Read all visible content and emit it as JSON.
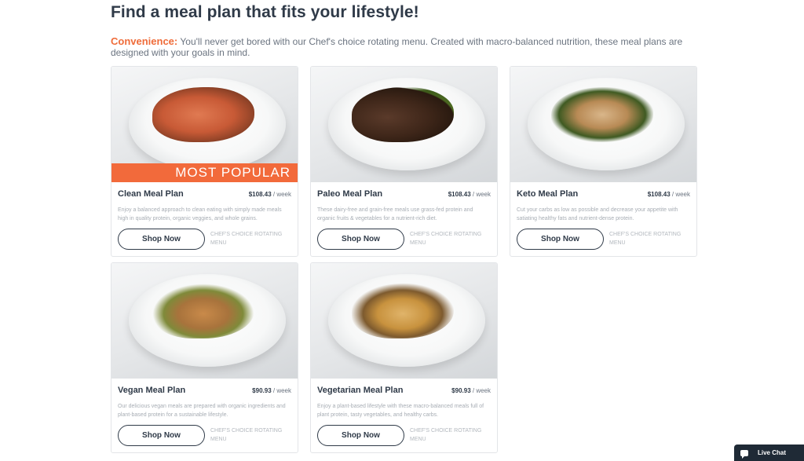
{
  "page": {
    "title": "Find a meal plan that fits your lifestyle!",
    "intro_keyword": "Convenience:",
    "intro_text": "You'll never get bored with our Chef's choice rotating menu. Created with macro-balanced nutrition, these meal plans are designed with your goals in mind."
  },
  "plans": [
    {
      "name": "Clean Meal Plan",
      "price": "$108.43",
      "price_unit": "/ week",
      "badge": "MOST POPULAR",
      "description": "Enjoy a balanced approach to clean eating with simply made meals high in quality protein, organic veggies, and whole grains.",
      "button": "Shop Now",
      "note": "CHEF'S CHOICE ROTATING MENU"
    },
    {
      "name": "Paleo Meal Plan",
      "price": "$108.43",
      "price_unit": "/ week",
      "description": "These dairy-free and grain-free meals use grass-fed protein and organic fruits & vegetables for a nutrient-rich diet.",
      "button": "Shop Now",
      "note": "CHEF'S CHOICE ROTATING MENU"
    },
    {
      "name": "Keto Meal Plan",
      "price": "$108.43",
      "price_unit": "/ week",
      "description": "Cut your carbs as low as possible and decrease your appetite with satiating healthy fats and nutrient-dense protein.",
      "button": "Shop Now",
      "note": "CHEF'S CHOICE ROTATING MENU"
    },
    {
      "name": "Vegan Meal Plan",
      "price": "$90.93",
      "price_unit": "/ week",
      "description": "Our delicious vegan meals are prepared with organic ingredients and plant-based protein for a sustainable lifestyle.",
      "button": "Shop Now",
      "note": "CHEF'S CHOICE ROTATING MENU"
    },
    {
      "name": "Vegetarian Meal Plan",
      "price": "$90.93",
      "price_unit": "/ week",
      "description": "Enjoy a plant-based lifestyle with these macro-balanced meals full of plant protein, tasty vegetables, and healthy carbs.",
      "button": "Shop Now",
      "note": "CHEF'S CHOICE ROTATING MENU"
    }
  ],
  "chat": {
    "label": "Live Chat",
    "icon": "chat-bubble-icon"
  },
  "colors": {
    "accent": "#f26a3b",
    "heading": "#2f3a48",
    "chat_bg": "#1f2a36"
  }
}
